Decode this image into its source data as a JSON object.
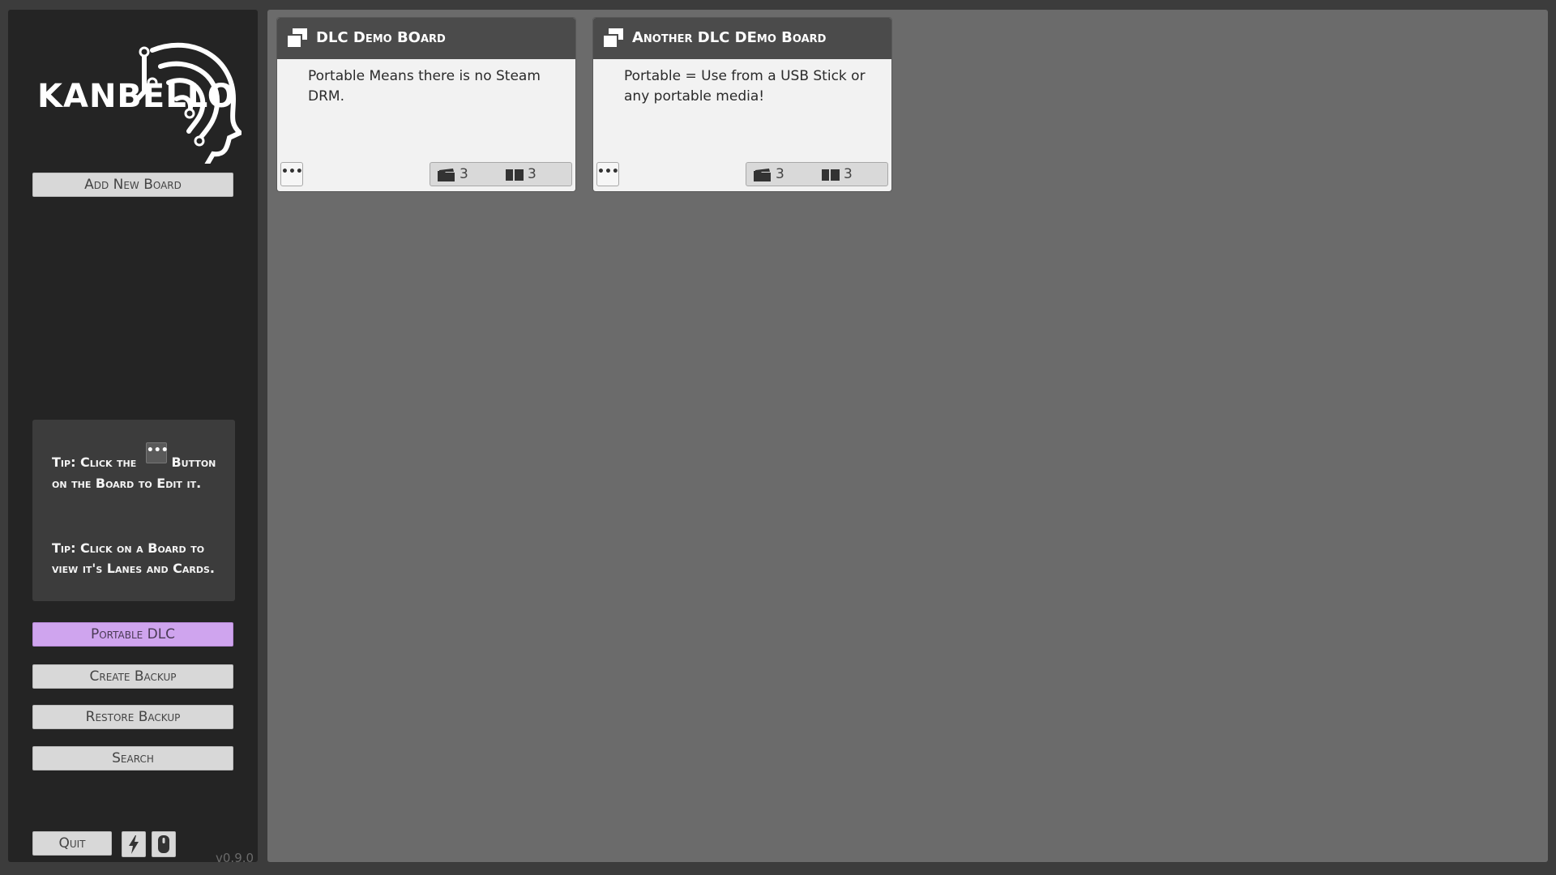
{
  "sidebar": {
    "logo_text": "KANBELLO",
    "add_board_label": "Add New Board",
    "tips": [
      {
        "before": "Tip: Click the",
        "after": "Button on the Board to Edit it.",
        "button_glyph": "•••"
      },
      {
        "text": "Tip: Click on a Board to view it's Lanes and Cards."
      }
    ],
    "portable_label": "Portable DLC",
    "create_backup_label": "Create Backup",
    "restore_backup_label": "Restore Backup",
    "search_label": "Search",
    "quit_label": "Quit",
    "version": "v0.9.0",
    "icons": [
      "lightning-icon",
      "mouse-icon"
    ]
  },
  "boards": [
    {
      "title": "DLC Demo BOard",
      "description": "Portable Means there is no Steam DRM.",
      "menu_glyph": "•••",
      "lanes": "3",
      "cards": "3"
    },
    {
      "title": "Another DLC DEmo Board",
      "description": "Portable = Use from a USB Stick or any portable media!",
      "menu_glyph": "•••",
      "lanes": "3",
      "cards": "3"
    }
  ],
  "colors": {
    "sidebar_bg": "#242424",
    "main_bg": "#6b6b6b",
    "accent_portable": "#cfa4ee",
    "board_header": "#4b4b4b",
    "board_body": "#f2f2f2"
  }
}
